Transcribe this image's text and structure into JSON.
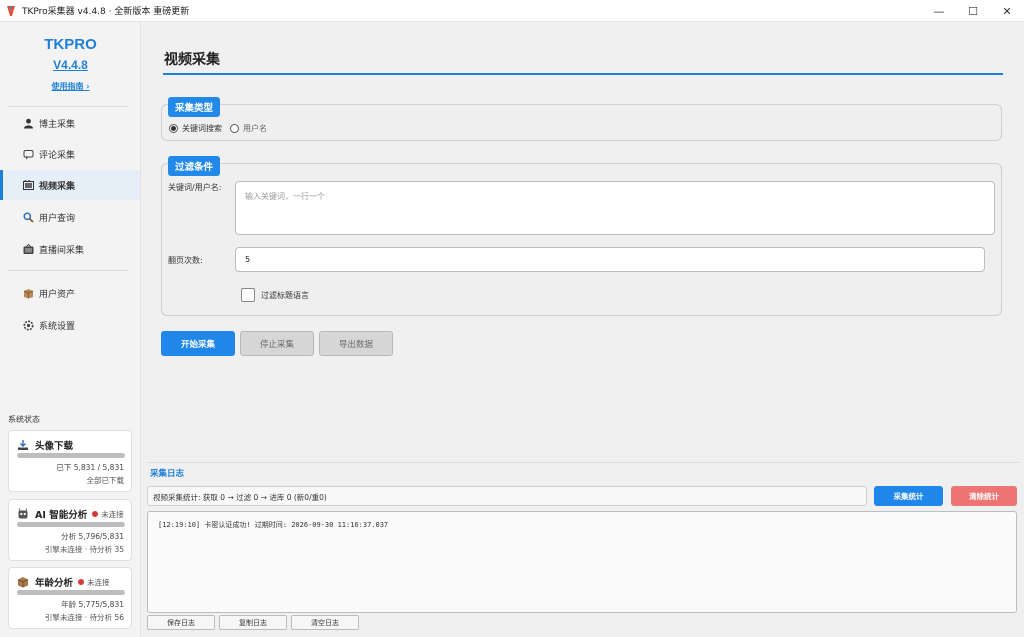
{
  "window": {
    "title": "TKPro采集器 v4.4.8 · 全新版本 重磅更新",
    "minimize": "—",
    "maximize": "☐",
    "close": "✕"
  },
  "brand": {
    "name": "TKPRO",
    "version": "V4.4.8",
    "guide": "使用指南 ›"
  },
  "nav": {
    "items": [
      {
        "label": "博主采集",
        "icon": "person-icon"
      },
      {
        "label": "评论采集",
        "icon": "comment-icon"
      },
      {
        "label": "视频采集",
        "icon": "video-icon",
        "active": true
      },
      {
        "label": "用户查询",
        "icon": "search-icon"
      },
      {
        "label": "直播间采集",
        "icon": "live-icon"
      },
      {
        "label": "用户资产",
        "icon": "asset-icon"
      },
      {
        "label": "系统设置",
        "icon": "gear-icon"
      }
    ]
  },
  "system": {
    "title": "系统状态",
    "cards": [
      {
        "title": "头像下载",
        "status": "",
        "progress": 1.0,
        "line1": "已下 5,831 / 5,831",
        "line2": "全部已下载"
      },
      {
        "title": "AI 智能分析",
        "status": "未连接",
        "progress": 0.994,
        "line1": "分析 5,796/5,831",
        "line2": "引擎未连接 · 待分析 35"
      },
      {
        "title": "年龄分析",
        "status": "未连接",
        "progress": 0.99,
        "line1": "年龄 5,775/5,831",
        "line2": "引擎未连接 · 待分析 56"
      }
    ]
  },
  "main": {
    "title": "视频采集",
    "collect_type": {
      "badge": "采集类型",
      "options": [
        {
          "label": "关键词搜索",
          "selected": true
        },
        {
          "label": "用户名",
          "selected": false
        }
      ]
    },
    "filter": {
      "badge": "过滤条件",
      "keyword_label": "关键词/用户名:",
      "keyword_placeholder": "输入关键词，一行一个",
      "pages_label": "翻页次数:",
      "pages_value": "5",
      "lang_filter_label": "过滤标题语言"
    },
    "buttons": {
      "start": "开始采集",
      "stop": "停止采集",
      "export": "导出数据"
    }
  },
  "log": {
    "title": "采集日志",
    "stats": "视频采集统计: 获取 0 → 过滤 0 → 进库 0 (新0/重0)",
    "stats_button": "采集统计",
    "clear_stats_button": "清除统计",
    "lines": [
      "[12:19:10] 卡密认证成功! 过期时间: 2026-09-30 11:16:37.037"
    ],
    "save_button": "保存日志",
    "copy_button": "复制日志",
    "clear_button": "清空日志"
  }
}
